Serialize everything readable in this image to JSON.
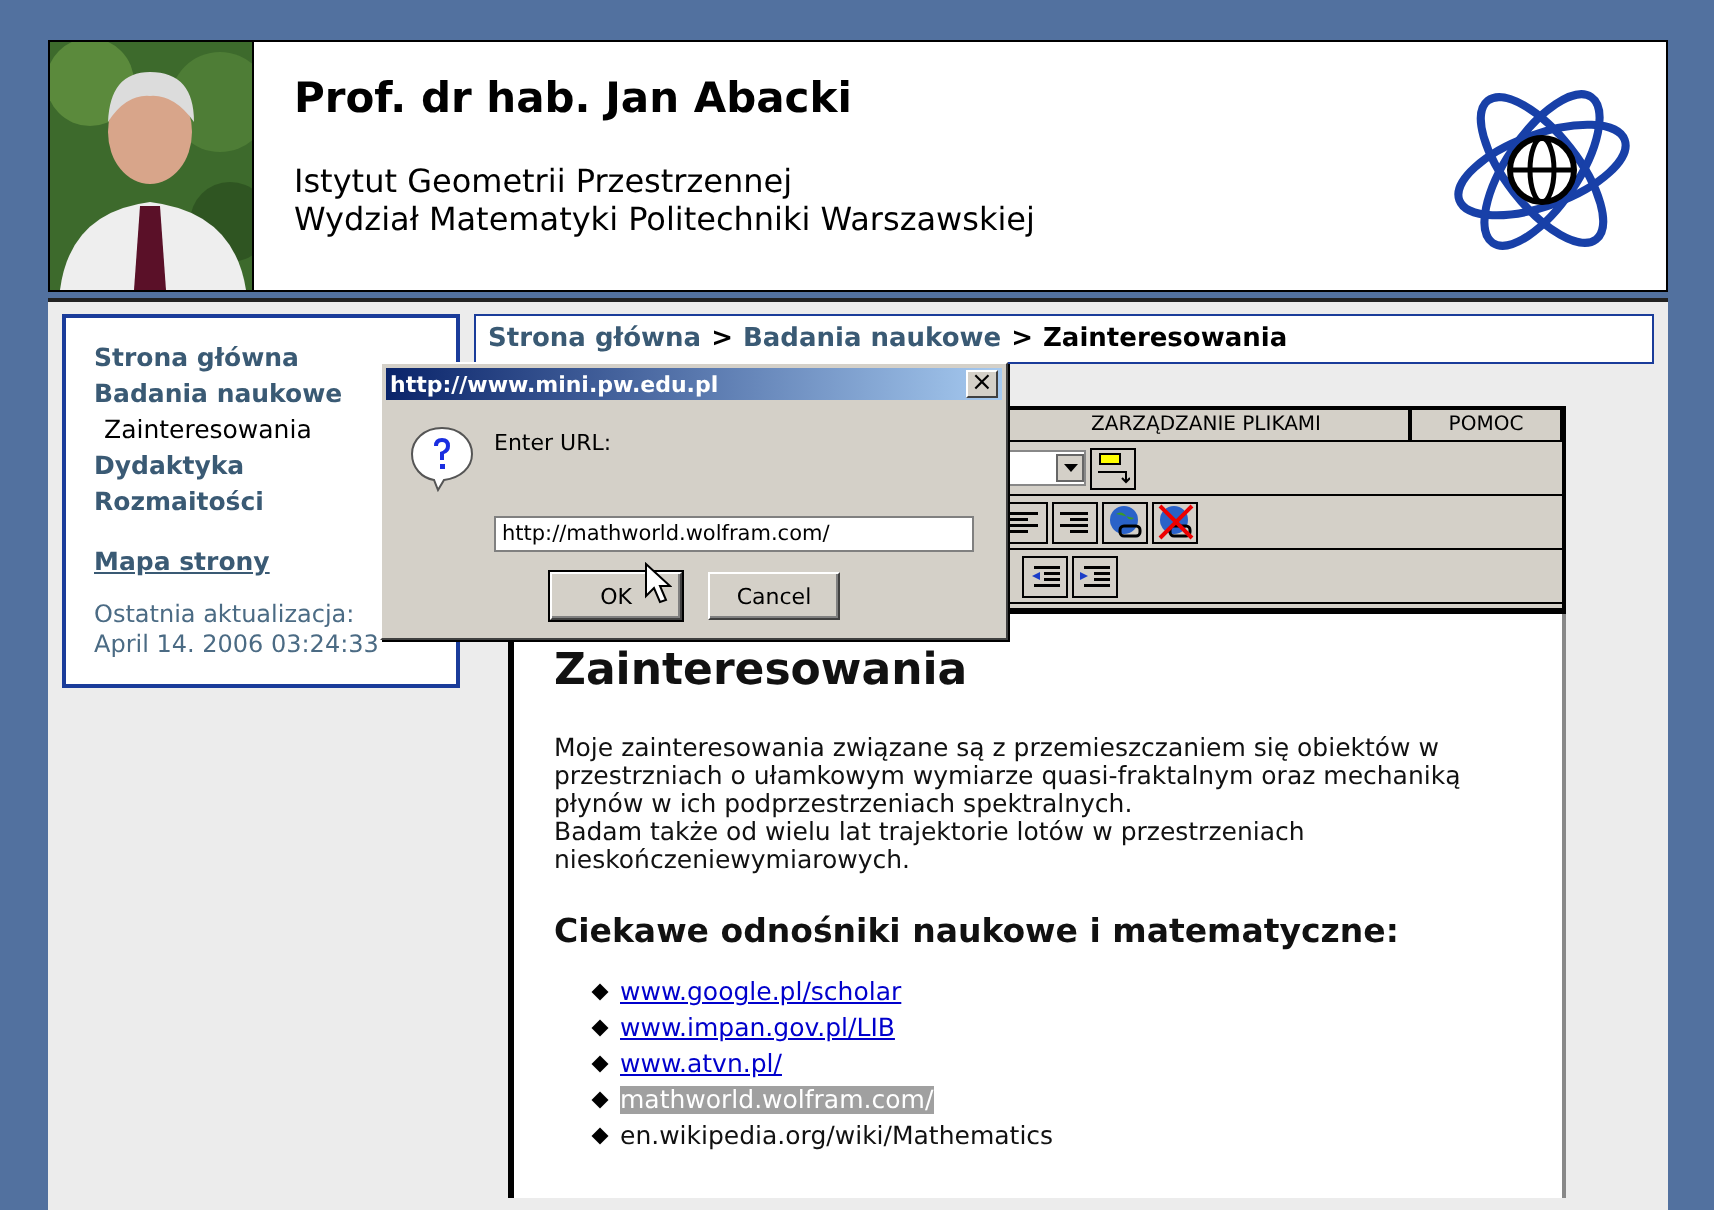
{
  "header": {
    "photo": {
      "kind": "picture"
    },
    "name": "Prof. dr hab. Jan Abacki",
    "affiliation": [
      "Istytut Geometrii Przestrzennej",
      "Wydział Matematyki Politechniki Warszawskiej"
    ]
  },
  "sidebar": {
    "items": [
      {
        "label": "Strona główna",
        "selected": false
      },
      {
        "label": "Badania naukowe",
        "selected": false,
        "children": [
          {
            "label": "Zainteresowania",
            "selected": true
          }
        ]
      },
      {
        "label": "Dydaktyka",
        "selected": false
      },
      {
        "label": "Rozmaitości",
        "selected": false
      }
    ],
    "sitemap_link": "Mapa strony",
    "last_update_label": "Ostatnia aktualizacja:",
    "last_update": "April 14. 2006 03:24:33"
  },
  "breadcrumb": {
    "separator": ">",
    "items": [
      {
        "label": "Strona główna",
        "current": false
      },
      {
        "label": "Badania naukowe",
        "current": false
      },
      {
        "label": "Zainteresowania",
        "current": true
      }
    ]
  },
  "editor": {
    "menu_tabs": [
      "ZARZĄDZANIE PLIKAMI",
      "POMOC"
    ]
  },
  "content": {
    "title": "Zainteresowania",
    "paragraphs": [
      "Moje zainteresowania związane są z przemieszczaniem się obiektów w przestrzniach o ułamkowym wymiarze quasi-fraktalnym oraz mechaniką płynów w ich podprzestrzeniach spektralnych.",
      "Badam także od wielu lat trajektorie lotów w przestrzeniach nieskończeniewymiarowych."
    ],
    "links_heading": "Ciekawe odnośniki naukowe i matematyczne:",
    "links": [
      {
        "text": "www.google.pl/scholar",
        "kind": "link",
        "selected": false
      },
      {
        "text": "www.impan.gov.pl/LIB",
        "kind": "link",
        "selected": false
      },
      {
        "text": "www.atvn.pl/",
        "kind": "link",
        "selected": false
      },
      {
        "text": "mathworld.wolfram.com/",
        "kind": "text",
        "selected": true
      },
      {
        "text": "en.wikipedia.org/wiki/Mathematics",
        "kind": "text",
        "selected": false
      }
    ]
  },
  "dialog": {
    "title": "http://www.mini.pw.edu.pl",
    "close": "×",
    "prompt": "Enter URL:",
    "value": "http://mathworld.wolfram.com/",
    "buttons": [
      "OK",
      "Cancel"
    ]
  }
}
